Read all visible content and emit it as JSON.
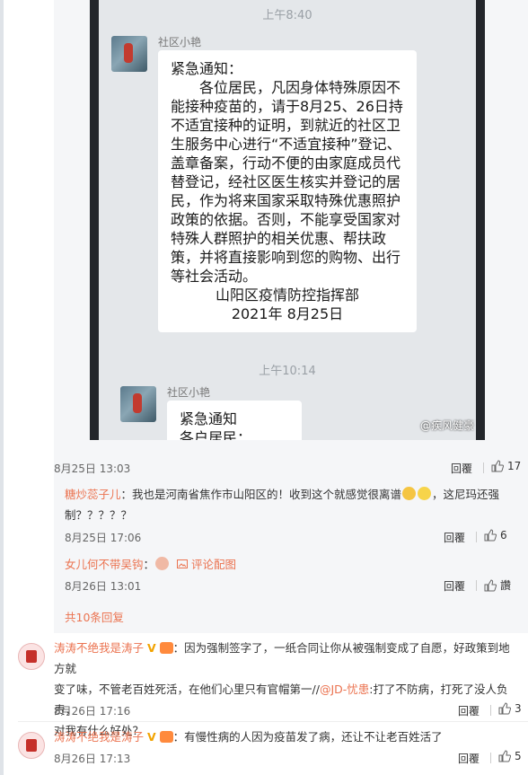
{
  "photo": {
    "time_top": "上午8:40",
    "sender1": "社区小艳",
    "notice_title": "紧急通知：",
    "notice_body": "各位居民，凡因身体特殊原因不能接种疫苗的，请于8月25、26日持不适宜接种的证明，到就近的社区卫生服务中心进行“不适宜接种”登记、盖章备案，行动不便的由家庭成员代替登记，经社区医生核实并登记的居民，作为将来国家采取特殊优惠照护政策的依据。否则，不能享受国家对特殊人群照护的相关优惠、帮扶政策，并将直接影响到您的购物、出行等社会活动。",
    "sign_org": "山阳区疫情防控指挥部",
    "sign_date": "2021年 8月25日",
    "time_mid": "上午10:14",
    "sender2": "社区小艳",
    "notice2_title": "紧急通知",
    "notice2_line": "各户居民：",
    "watermark": "@疾风健豪"
  },
  "post": {
    "date": "8月25日 13:03",
    "reply": "回覆",
    "likes": "17"
  },
  "sub1": {
    "user": "糖炒蕊子儿",
    "text_a": "：我也是河南省焦作市山阳区的！收到这个就感觉很离谱",
    "text_b": "，这尼玛还强",
    "text_c": "制？？？？？",
    "date": "8月25日 17:06",
    "reply": "回覆",
    "likes": "6"
  },
  "sub2": {
    "user": "女儿何不带吴钩",
    "text": "：",
    "pic_link": "评论配图",
    "date": "8月26日 13:01",
    "reply": "回覆",
    "likes": "讚"
  },
  "more_replies": "共10条回复",
  "c2": {
    "user": "涛涛不绝我是涛子",
    "text_a": "：因为强制签字了，一纸合同让你从被强制变成了自愿，好政策到地方就",
    "text_b": "变了味，不管老百姓死活，在他们心里只有官帽第一//",
    "mention": "@JD-忧患",
    "text_c": ":打了不防病，打死了没人负责，",
    "text_d": "对我有什么好处？",
    "date": "8月26日 17:16",
    "reply": "回覆",
    "likes": "3"
  },
  "c3": {
    "user": "涛涛不绝我是涛子",
    "text": "：有慢性病的人因为疫苗发了病，还让不让老百姓活了",
    "date": "8月26日 17:13",
    "reply": "回覆",
    "likes": "5"
  },
  "colors": {
    "accent": "#eb7350",
    "thread_bg": "#f5f6f8",
    "vip": "#f2a300"
  }
}
